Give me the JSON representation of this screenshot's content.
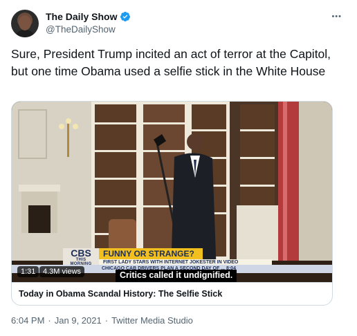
{
  "author": {
    "display_name": "The Daily Show",
    "handle": "@TheDailyShow",
    "verified": true
  },
  "more_icon": "more-options-icon",
  "tweet_text": "Sure, President Trump incited an act of terror at the Capitol, but one time Obama used a selfie stick in the White House",
  "media": {
    "duration": "1:31",
    "views": "4.3M views",
    "caption": "Critics called it undignified.",
    "broadcast": {
      "network": "CBS",
      "show_line1": "THIS",
      "show_line2": "MORNING",
      "headline": "FUNNY OR STRANGE?",
      "subheadline": "FIRST LADY STARS WITH INTERNET JOKESTER IN VIDEO",
      "ticker": "CHICAGO CAB DRIVERS PLAN A SECOND DAY OF ... 8:04"
    },
    "card_title": "Today in Obama Scandal History: The Selfie Stick"
  },
  "meta": {
    "time": "6:04 PM",
    "separator": "·",
    "date": "Jan 9, 2021",
    "source": "Twitter Media Studio"
  },
  "colors": {
    "verified_blue": "#1d9bf0",
    "secondary_text": "#536471",
    "border": "#cfd9de"
  }
}
